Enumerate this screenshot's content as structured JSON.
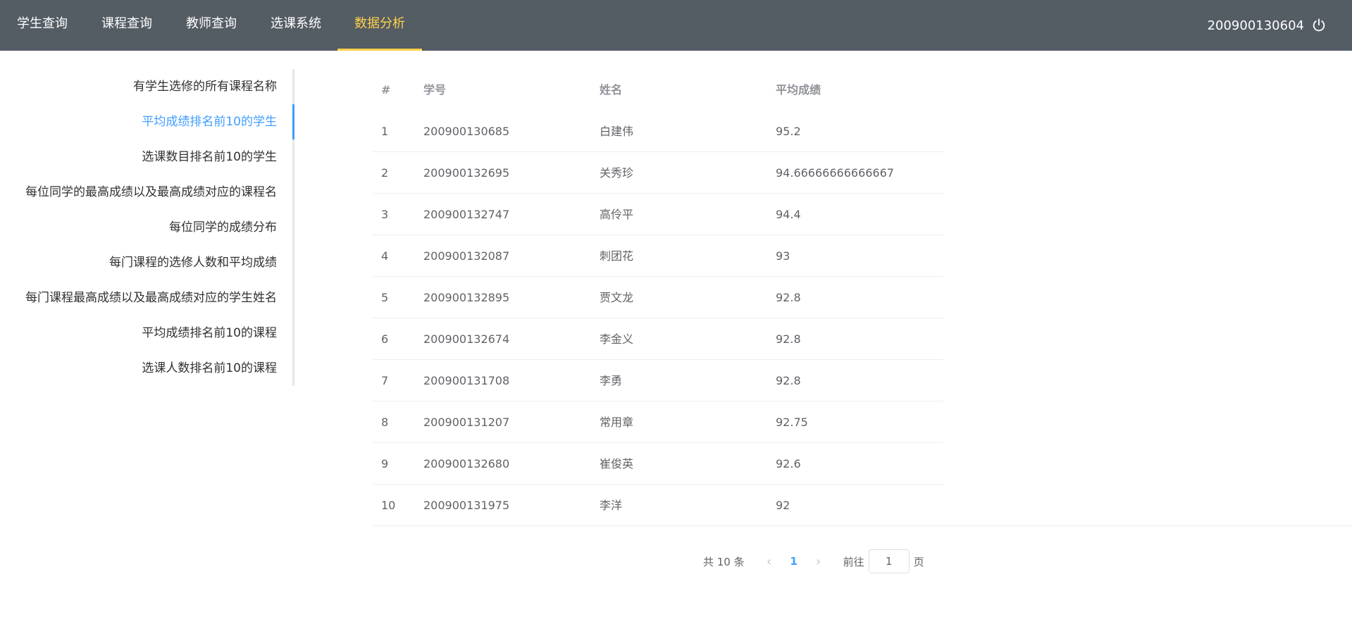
{
  "nav": {
    "items": [
      {
        "label": "学生查询"
      },
      {
        "label": "课程查询"
      },
      {
        "label": "教师查询"
      },
      {
        "label": "选课系统"
      },
      {
        "label": "数据分析"
      }
    ],
    "active_index": 4,
    "user_id": "200900130604",
    "logout_icon": "power-icon"
  },
  "sidebar": {
    "items": [
      {
        "label": "有学生选修的所有课程名称"
      },
      {
        "label": "平均成绩排名前10的学生"
      },
      {
        "label": "选课数目排名前10的学生"
      },
      {
        "label": "每位同学的最高成绩以及最高成绩对应的课程名"
      },
      {
        "label": "每位同学的成绩分布"
      },
      {
        "label": "每门课程的选修人数和平均成绩"
      },
      {
        "label": "每门课程最高成绩以及最高成绩对应的学生姓名"
      },
      {
        "label": "平均成绩排名前10的课程"
      },
      {
        "label": "选课人数排名前10的课程"
      }
    ],
    "active_index": 1
  },
  "table": {
    "headers": [
      "#",
      "学号",
      "姓名",
      "平均成绩"
    ],
    "rows": [
      [
        "1",
        "200900130685",
        "白建伟",
        "95.2"
      ],
      [
        "2",
        "200900132695",
        "关秀珍",
        "94.66666666666667"
      ],
      [
        "3",
        "200900132747",
        "高伶平",
        "94.4"
      ],
      [
        "4",
        "200900132087",
        "刺团花",
        "93"
      ],
      [
        "5",
        "200900132895",
        "贾文龙",
        "92.8"
      ],
      [
        "6",
        "200900132674",
        "李金义",
        "92.8"
      ],
      [
        "7",
        "200900131708",
        "李勇",
        "92.8"
      ],
      [
        "8",
        "200900131207",
        "常用章",
        "92.75"
      ],
      [
        "9",
        "200900132680",
        "崔俊英",
        "92.6"
      ],
      [
        "10",
        "200900131975",
        "李洋",
        "92"
      ]
    ]
  },
  "pagination": {
    "total_text": "共 10 条",
    "prev_icon": "chevron-left-icon",
    "current_page": "1",
    "next_icon": "chevron-right-icon",
    "goto_label": "前往",
    "goto_value": "1",
    "page_suffix": "页"
  },
  "colors": {
    "topbar_bg": "#545c64",
    "nav_active": "#ffd04b",
    "accent": "#409eff"
  }
}
